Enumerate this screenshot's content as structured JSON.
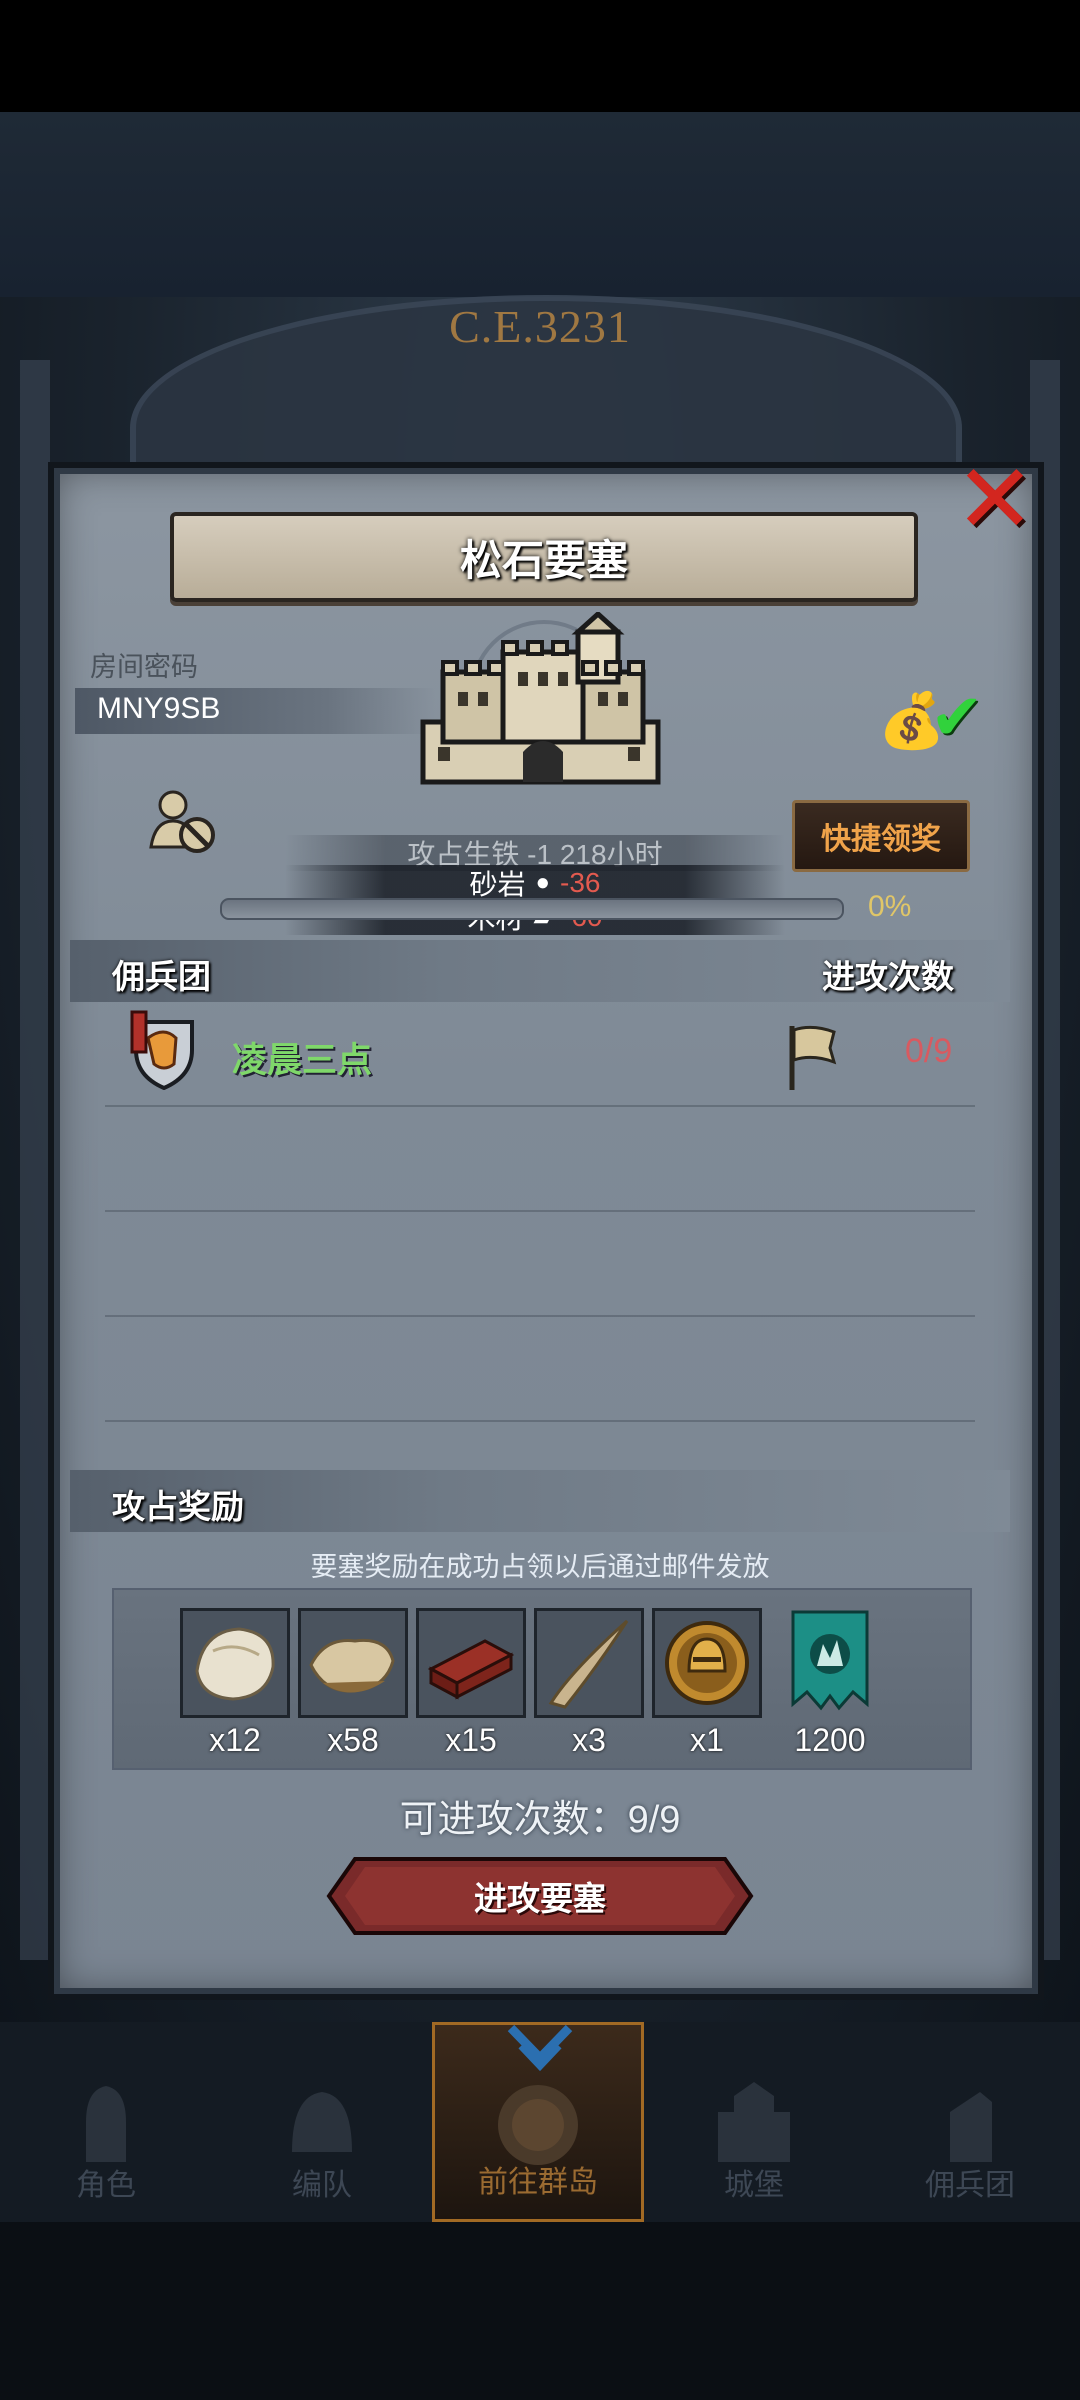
{
  "era": "C.E.3231",
  "fortress": {
    "title": "松石要塞",
    "room_label": "房间密码",
    "room_code": "MNY9SB",
    "claim_button": "快捷领奖"
  },
  "ticker": {
    "faded": "攻占生铁 -1 218小时",
    "rows": [
      {
        "label": "砂岩",
        "value": "-36",
        "icon": "stone-icon"
      },
      {
        "label": "木材",
        "value": "-60",
        "icon": "wood-icon"
      }
    ]
  },
  "progress": {
    "percent": 0,
    "text": "0%"
  },
  "mercenary_section": {
    "title": "佣兵团",
    "attacks_header": "进攻次数",
    "rows": [
      {
        "name": "凌晨三点",
        "count": "0/9"
      }
    ]
  },
  "rewards": {
    "title": "攻占奖励",
    "note": "要塞奖励在成功占领以后通过邮件发放",
    "items": [
      {
        "icon": "fur-pelt-icon",
        "qty": "x12"
      },
      {
        "icon": "hide-icon",
        "qty": "x58"
      },
      {
        "icon": "timber-icon",
        "qty": "x15"
      },
      {
        "icon": "horn-icon",
        "qty": "x3"
      },
      {
        "icon": "helmet-medal-icon",
        "qty": "x1"
      },
      {
        "icon": "banner-icon",
        "qty": "1200"
      }
    ]
  },
  "attacks_left": "可进攻次数：9/9",
  "attack_button": "进攻要塞",
  "nav": [
    {
      "label": "角色",
      "icon": "knight-icon"
    },
    {
      "label": "编队",
      "icon": "helmet-icon"
    },
    {
      "label": "前往群岛",
      "icon": "compass-icon",
      "active": true
    },
    {
      "label": "城堡",
      "icon": "castle-icon"
    },
    {
      "label": "佣兵团",
      "icon": "mercenary-icon"
    }
  ],
  "colors": {
    "accent_red": "#d3261f",
    "merc_green": "#7fd86a",
    "count_red": "#d85a60",
    "gold": "#e0c668"
  }
}
